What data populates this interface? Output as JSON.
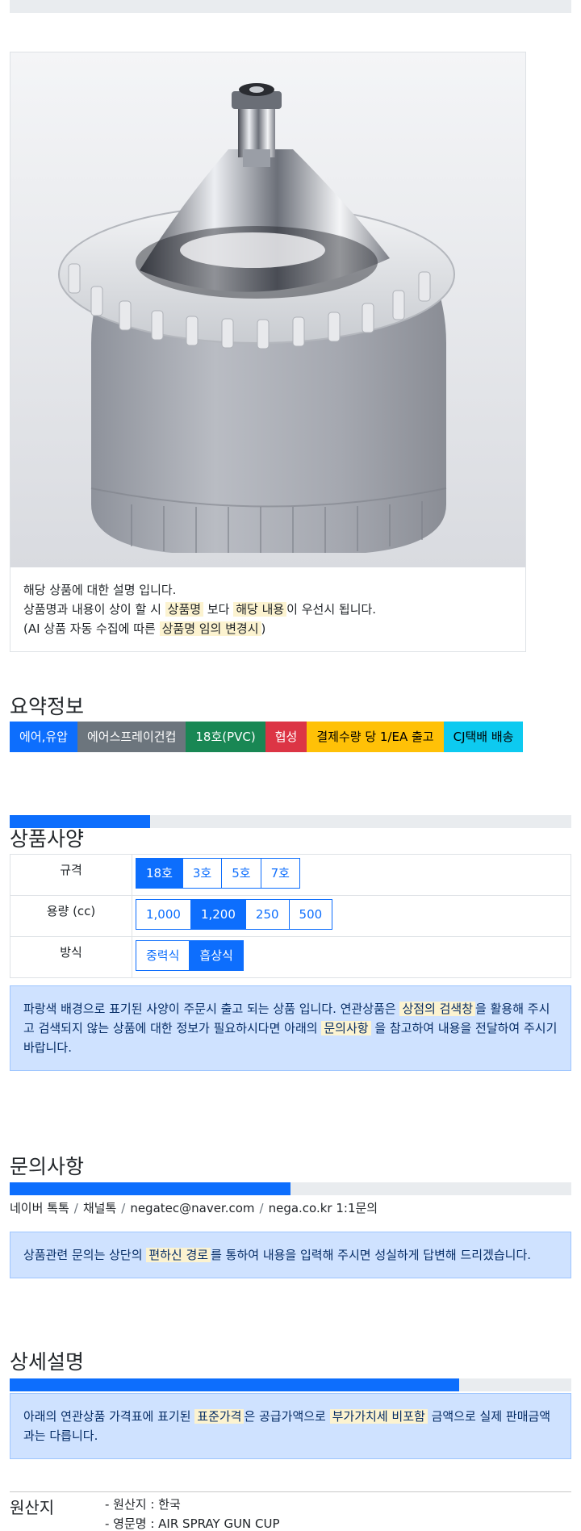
{
  "product": {
    "image_alt": "에어스프레이건컵 18호 제품 사진",
    "desc_line1": "해당 상품에 대한 설명 입니다.",
    "desc_line2_a": "상품명과 내용이 상이 할 시 ",
    "desc_line2_mark1": "상품명",
    "desc_line2_b": " 보다 ",
    "desc_line2_mark2": "해당 내용",
    "desc_line2_c": "이 우선시 됩니다.",
    "desc_line3_a": "(AI 상품 자동 수집에 따른 ",
    "desc_line3_mark": "상품명 임의 변경시",
    "desc_line3_b": ")"
  },
  "summary": {
    "title": "요약정보",
    "badges": [
      {
        "label": "에어,유압",
        "color": "#0d6efd",
        "text_color": "#ffffff"
      },
      {
        "label": "에어스프레이건컵",
        "color": "#6c757d",
        "text_color": "#ffffff"
      },
      {
        "label": "18호(PVC)",
        "color": "#198754",
        "text_color": "#ffffff"
      },
      {
        "label": "협성",
        "color": "#dc3545",
        "text_color": "#ffffff"
      },
      {
        "label": "결제수량 당 1/EA 출고",
        "color": "#ffc107",
        "text_color": "#000000"
      },
      {
        "label": "CJ택배 배송",
        "color": "#0dcaf0",
        "text_color": "#000000"
      }
    ]
  },
  "specs": {
    "title": "상품사양",
    "progress_fraction": 0.25,
    "rows": [
      {
        "label": "규격",
        "options": [
          "18호",
          "3호",
          "5호",
          "7호"
        ],
        "active": 0
      },
      {
        "label": "용량 (cc)",
        "options": [
          "1,000",
          "1,200",
          "250",
          "500"
        ],
        "active": 1
      },
      {
        "label": "방식",
        "options": [
          "중력식",
          "흡상식"
        ],
        "active": 1
      }
    ],
    "notice_a": "파랑색 배경으로 표기된 사양이 주문시 출고 되는 상품 입니다. 연관상품은 ",
    "notice_mark1": "상점의 검색창",
    "notice_b": "을 활용해 주시고 검색되지 않는 상품에 대한 정보가 필요하시다면 아래의 ",
    "notice_mark2": "문의사항",
    "notice_c": " 을 참고하여 내용을 전달하여 주시기 바랍니다."
  },
  "inquiry": {
    "title": "문의사항",
    "progress_fraction": 0.5,
    "channels": [
      "네이버 톡톡",
      "채널톡",
      "negatec@naver.com",
      "nega.co.kr 1:1문의"
    ],
    "separator": "/",
    "notice_a": "상품관련 문의는 상단의 ",
    "notice_mark": "편하신 경로",
    "notice_b": "를 통하여 내용을 입력해 주시면 성실하게 답변해 드리겠습니다."
  },
  "details": {
    "title": "상세설명",
    "progress_fraction": 0.8,
    "notice_a": "아래의 연관상품 가격표에 표기된 ",
    "notice_mark1": "표준가격",
    "notice_b": "은 공급가액으로 ",
    "notice_mark2": "부가가치세 비포함",
    "notice_c": " 금액으로 실제 판매금액과는 다릅니다."
  },
  "origin": {
    "label": "원산지",
    "line1": "- 원산지 : 한국",
    "line2": "- 영문명 : AIR SPRAY GUN CUP"
  },
  "colors": {
    "primary": "#0d6efd",
    "notice_bg": "#cfe2ff",
    "mark_bg": "#fcf3d0"
  }
}
